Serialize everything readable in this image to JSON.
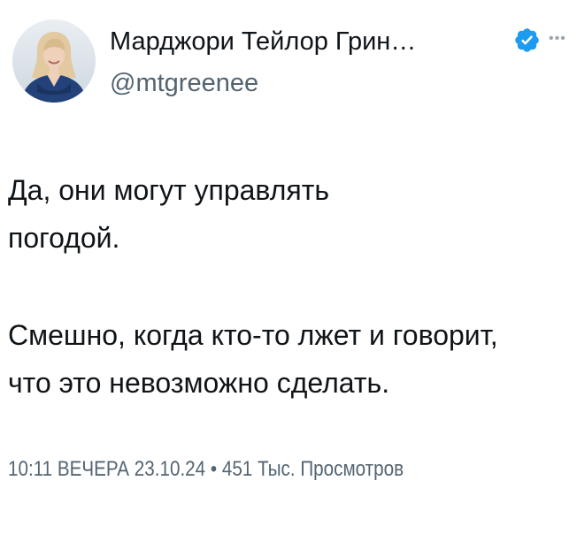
{
  "author": {
    "display_name": "Марджори Тейлор Грин…",
    "handle": "@mtgreenee",
    "verified_icon": "verified-badge-icon",
    "more_icon": "more-options-icon"
  },
  "tweet": {
    "paragraphs": [
      "Да, они могут управлять\nпогодой.",
      "Смешно, когда кто-то лжет и говорит,\nчто это невозможно сделать."
    ],
    "timestamp": "10:11 ВЕЧЕРА 23.10.24",
    "separator": "•",
    "views": "451 Тыс. Просмотров"
  },
  "colors": {
    "text_primary": "#0f1419",
    "text_secondary": "#536471",
    "verified_blue": "#1d9bf0",
    "background": "#ffffff"
  }
}
